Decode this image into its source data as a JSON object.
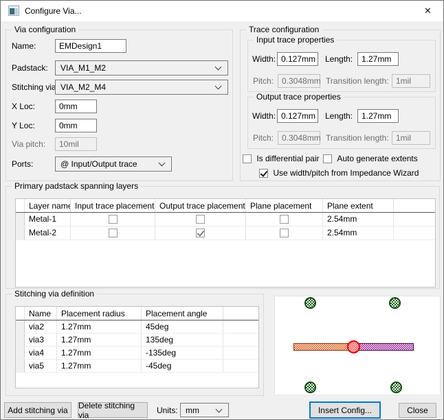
{
  "window": {
    "title": "Configure Via...",
    "close_glyph": "✕"
  },
  "via_configuration": {
    "title": "Via configuration",
    "name_label": "Name:",
    "name_value": "EMDesign1",
    "padstack_label": "Padstack:",
    "padstack_value": "VIA_M1_M2",
    "stitching_label": "Stitching via:",
    "stitching_value": "VIA_M2_M4",
    "xloc_label": "X Loc:",
    "xloc_value": "0mm",
    "yloc_label": "Y Loc:",
    "yloc_value": "0mm",
    "via_pitch_label": "Via pitch:",
    "via_pitch_value": "10mil",
    "ports_label": "Ports:",
    "ports_value": "@ Input/Output trace"
  },
  "trace_configuration": {
    "title": "Trace configuration",
    "input": {
      "title": "Input trace properties",
      "width_label": "Width:",
      "width_value": "0.127mm",
      "length_label": "Length:",
      "length_value": "1.27mm",
      "pitch_label": "Pitch:",
      "pitch_value": "0.3048mm",
      "transition_label": "Transition length:",
      "transition_value": "1mil"
    },
    "output": {
      "title": "Output trace properties",
      "width_label": "Width:",
      "width_value": "0.127mm",
      "length_label": "Length:",
      "length_value": "1.27mm",
      "pitch_label": "Pitch:",
      "pitch_value": "0.3048mm",
      "transition_label": "Transition length:",
      "transition_value": "1mil"
    },
    "checkboxes": {
      "diff_pair": {
        "label": "Is differential pair",
        "checked": false
      },
      "auto_extents": {
        "label": "Auto generate extents",
        "checked": false
      },
      "impedance_wizard": {
        "label": "Use width/pitch from Impedance Wizard",
        "checked": true
      }
    }
  },
  "padstack_layers": {
    "title": "Primary padstack spanning layers",
    "columns": [
      "Layer name",
      "Input trace placement",
      "Output trace placement",
      "Plane placement",
      "Plane extent"
    ],
    "rows": [
      {
        "layer": "Metal-1",
        "input": false,
        "output": false,
        "plane": false,
        "extent": "2.54mm"
      },
      {
        "layer": "Metal-2",
        "input": false,
        "output": true,
        "plane": false,
        "extent": "2.54mm"
      }
    ]
  },
  "stitching_definition": {
    "title": "Stitching via definition",
    "columns": [
      "Name",
      "Placement radius",
      "Placement angle"
    ],
    "rows": [
      {
        "name": "via2",
        "radius": "1.27mm",
        "angle": "45deg"
      },
      {
        "name": "via3",
        "radius": "1.27mm",
        "angle": "135deg"
      },
      {
        "name": "via4",
        "radius": "1.27mm",
        "angle": "-135deg"
      },
      {
        "name": "via5",
        "radius": "1.27mm",
        "angle": "-45deg"
      }
    ]
  },
  "preview": {
    "colors": {
      "stitching_via": "#1a661a",
      "input_trace": "#d34a00",
      "output_trace": "#8a0d8a",
      "center_via": "#ff2a2a"
    }
  },
  "footer": {
    "add_button": "Add stitching via",
    "delete_button": "Delete stitching via",
    "units_label": "Units:",
    "units_value": "mm",
    "insert_button": "Insert Config...",
    "close_button": "Close"
  }
}
